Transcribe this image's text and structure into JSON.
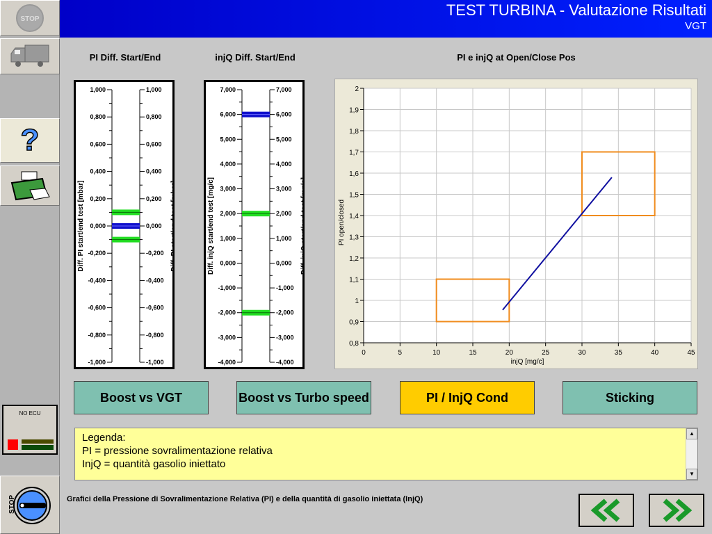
{
  "header": {
    "title": "TEST TURBINA - Valutazione Risultati",
    "subtitle": "VGT"
  },
  "sidebar": {
    "stop_label": "STOP",
    "ecu_status": "NO ECU",
    "key_label": "STOP"
  },
  "gauges": [
    {
      "title": "PI Diff. Start/End",
      "axis_label": "Diff. PI start/end test [mbar]",
      "range": [
        -1,
        1
      ],
      "ticks": [
        "1,000",
        "0,800",
        "0,600",
        "0,400",
        "0,200",
        "0,000",
        "-0,200",
        "-0,400",
        "-0,600",
        "-0,800",
        "-1,000"
      ],
      "limits": [
        0.1,
        -0.1
      ],
      "value": 0.0
    },
    {
      "title": "injQ Diff. Start/End",
      "axis_label": "Diff. injQ start/end test [mg/c]",
      "range": [
        -4000,
        7000
      ],
      "ticks": [
        "7,000",
        "6,000",
        "5,000",
        "4,000",
        "3,000",
        "2,000",
        "1,000",
        "0,000",
        "-1,000",
        "-2,000",
        "-3,000",
        "-4,000"
      ],
      "limits": [
        2000,
        -2000
      ],
      "value": 6000
    }
  ],
  "chart_data": {
    "type": "line",
    "title": "PI e injQ at Open/Close Pos",
    "xlabel": "injQ [mg/c]",
    "ylabel": "PI open/closed",
    "xlim": [
      0,
      45
    ],
    "ylim": [
      0.8,
      2
    ],
    "grid": true,
    "xticks": [
      "0",
      "5",
      "10",
      "15",
      "20",
      "25",
      "30",
      "35",
      "40",
      "45"
    ],
    "yticks": [
      "0,8",
      "0,9",
      "1",
      "1,1",
      "1,2",
      "1,3",
      "1,4",
      "1,5",
      "1,6",
      "1,7",
      "1,8",
      "1,9",
      "2"
    ],
    "series": [
      {
        "x": [
          19.1,
          34.1
        ],
        "y": [
          0.955,
          1.58
        ],
        "color": "#1010a0"
      }
    ],
    "regions": [
      {
        "x": [
          10,
          20
        ],
        "y": [
          0.9,
          1.1
        ],
        "color": "#f08c1e"
      },
      {
        "x": [
          30,
          40
        ],
        "y": [
          1.4,
          1.7
        ],
        "color": "#f08c1e"
      }
    ]
  },
  "buttons": [
    {
      "label": "Boost vs VGT"
    },
    {
      "label": "Boost vs Turbo speed"
    },
    {
      "label": "PI / InjQ Cond",
      "active": true
    },
    {
      "label": "Sticking"
    }
  ],
  "legend": {
    "lines": [
      "Legenda:",
      "PI = pressione sovralimentazione relativa",
      "InjQ = quantità gasolio iniettato"
    ]
  },
  "footer": "Grafici della Pressione di Sovralimentazione Relativa (PI) e della quantità di gasolio iniettata (InjQ)",
  "colors": {
    "accent": "#ffcc00",
    "button": "#7fc0b0",
    "limit": "#22dd22",
    "value": "#1010cc"
  }
}
